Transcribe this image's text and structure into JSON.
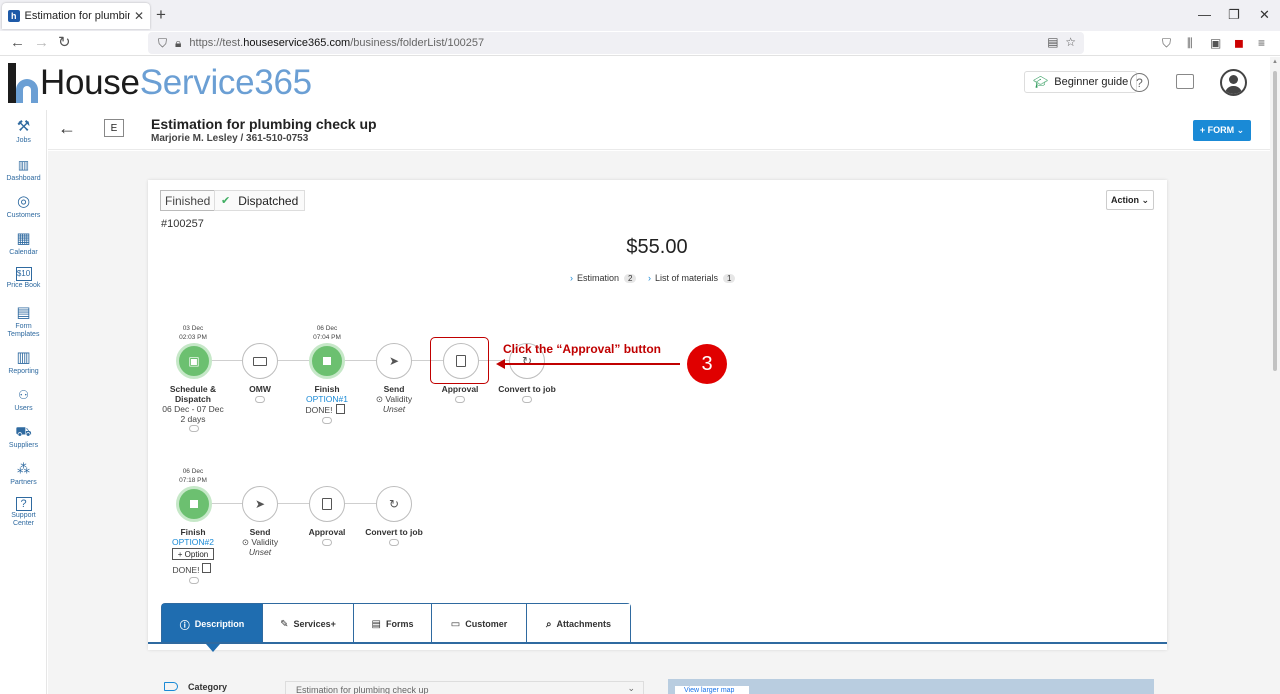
{
  "browser": {
    "tab_title": "Estimation for plumbing check",
    "tab_close": "✕",
    "new_tab": "+",
    "url_prefix": "https://test.",
    "url_domain": "houseservice365.com",
    "url_path": "/business/folderList/100257",
    "win_min": "—",
    "win_max": "❐",
    "win_close": "✕"
  },
  "header": {
    "logo_house": "House",
    "logo_service": "Service365",
    "guide_label": "Beginner guide",
    "help_icon": "?"
  },
  "sidebar": {
    "items": [
      {
        "label": "Jobs",
        "icon": "tools-icon",
        "glyph": "⚒"
      },
      {
        "label": "Dashboard",
        "icon": "bar-chart-icon",
        "glyph": "📊"
      },
      {
        "label": "Customers",
        "icon": "customers-icon",
        "glyph": "◎"
      },
      {
        "label": "Calendar",
        "icon": "calendar-icon",
        "glyph": "▦"
      },
      {
        "label": "Price Book",
        "icon": "price-book-icon",
        "glyph": "$10"
      },
      {
        "label": "Form",
        "label2": "Templates",
        "icon": "form-templates-icon",
        "glyph": "▤"
      },
      {
        "label": "Reporting",
        "icon": "reporting-icon",
        "glyph": "▥"
      },
      {
        "label": "Users",
        "icon": "users-icon",
        "glyph": "👥"
      },
      {
        "label": "Suppliers",
        "icon": "suppliers-icon",
        "glyph": "🚚"
      },
      {
        "label": "Partners",
        "icon": "partners-icon",
        "glyph": "⁂"
      },
      {
        "label": "Support",
        "label2": "Center",
        "icon": "support-icon",
        "glyph": "?"
      }
    ]
  },
  "titlebar": {
    "back": "←",
    "type_badge": "E",
    "title": "Estimation for plumbing check up",
    "subtitle": "Marjorie M. Lesley / 361-510-0753",
    "form_button": "+ FORM ⌄"
  },
  "job": {
    "status_finished": "Finished",
    "status_dispatched": "Dispatched",
    "number": "#100257",
    "action_label": "Action ⌄",
    "price": "$55.00",
    "links": [
      {
        "label": "Estimation",
        "count": "2"
      },
      {
        "label": "List of materials",
        "count": "1"
      }
    ]
  },
  "workflow_row1": {
    "schedule": {
      "date1": "03 Dec",
      "time": "02:03 PM",
      "label1": "Schedule &",
      "label2": "Dispatch",
      "range": "06 Dec - 07 Dec",
      "duration": "2 days"
    },
    "omw": {
      "label": "OMW"
    },
    "finish": {
      "date1": "06 Dec",
      "time": "07:04 PM",
      "label": "Finish",
      "option": "OPTION#1",
      "done": "DONE!"
    },
    "send": {
      "label": "Send",
      "validity": "⊙ Validity",
      "unset": "Unset"
    },
    "approval": {
      "label": "Approval"
    },
    "convert": {
      "label": "Convert to job"
    }
  },
  "workflow_row2": {
    "finish": {
      "date1": "06 Dec",
      "time": "07:18 PM",
      "label": "Finish",
      "option": "OPTION#2",
      "plus_option": "+ Option",
      "done": "DONE!"
    },
    "send": {
      "label": "Send",
      "validity": "⊙ Validity",
      "unset": "Unset"
    },
    "approval": {
      "label": "Approval"
    },
    "convert": {
      "label": "Convert to job"
    }
  },
  "callout": {
    "text": "Click the “Approval” button",
    "step": "3"
  },
  "tabs": [
    {
      "label": "Description",
      "icon": "ⓘ"
    },
    {
      "label": "Services+",
      "icon": "✎"
    },
    {
      "label": "Forms",
      "icon": "▤"
    },
    {
      "label": "Customer",
      "icon": "▭"
    },
    {
      "label": "Attachments",
      "icon": "⌕"
    }
  ],
  "details": {
    "category_label": "Category",
    "category_value": "Estimation for plumbing check up",
    "map_button": "View larger map"
  },
  "colors": {
    "accent": "#1a8ad6",
    "done_green": "#6cc070",
    "annotation_red": "#c00000"
  }
}
